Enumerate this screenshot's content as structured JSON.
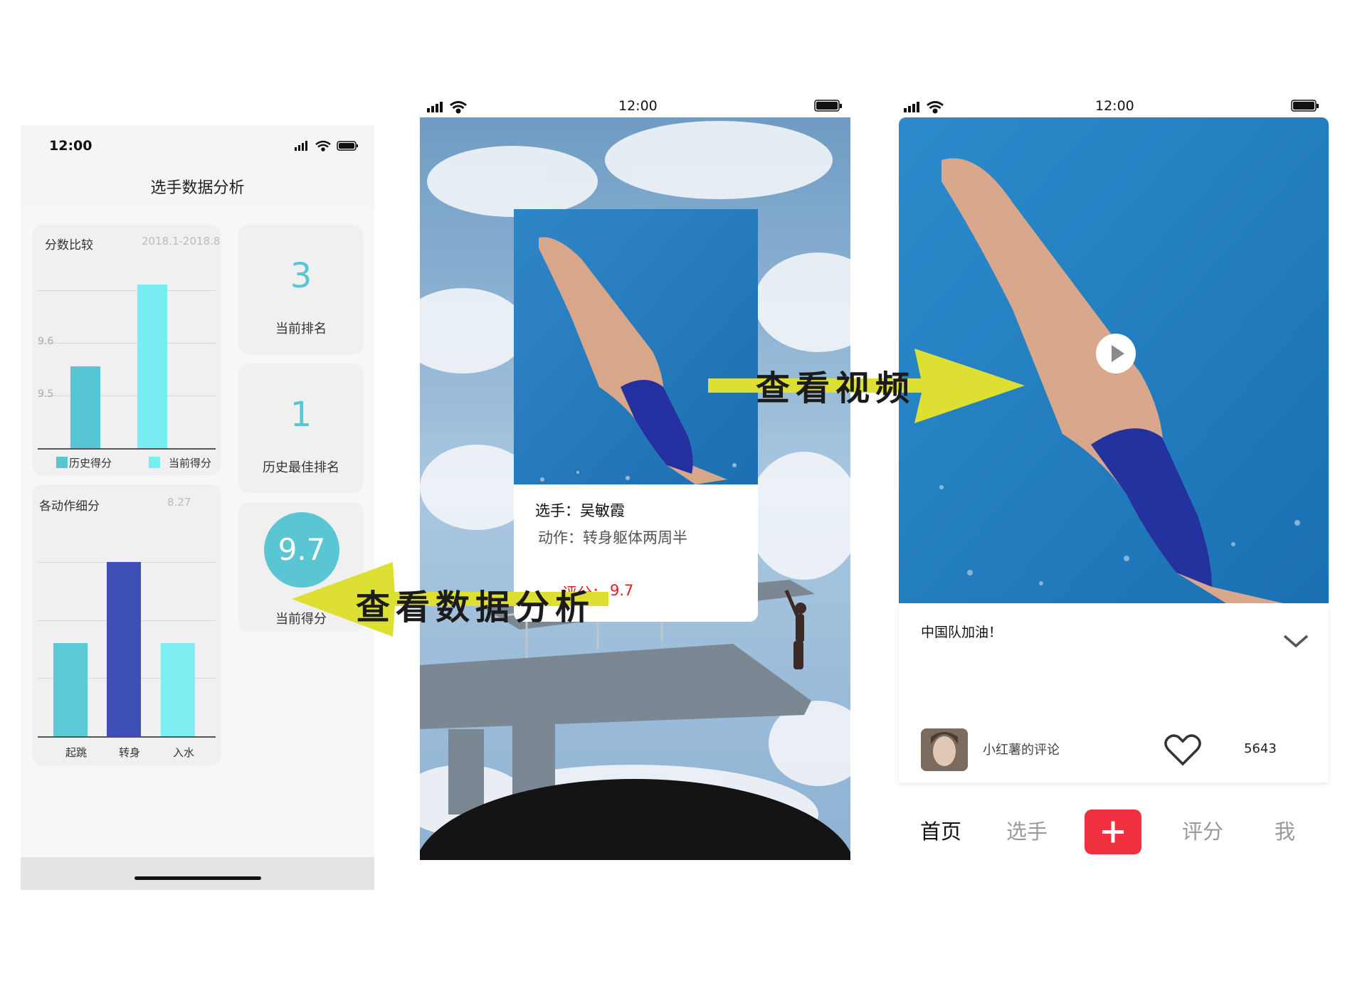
{
  "screen1": {
    "time": "12:00",
    "title": "选手数据分析",
    "score_compare": {
      "title": "分数比较",
      "date": "2018.1-2018.8",
      "y_ticks": [
        "9.6",
        "9.5"
      ],
      "legend": [
        "历史得分",
        "当前得分"
      ]
    },
    "action_breakdown": {
      "title": "各动作细分",
      "date": "8.27",
      "x_labels": [
        "起跳",
        "转身",
        "入水"
      ]
    },
    "stats": [
      {
        "value": "3",
        "label": "当前排名"
      },
      {
        "value": "1",
        "label": "历史最佳排名"
      },
      {
        "value": "9.7",
        "label": "当前得分"
      }
    ]
  },
  "chart_data": [
    {
      "type": "bar",
      "title": "分数比较",
      "subtitle": "2018.1-2018.8",
      "categories": [
        "历史得分",
        "当前得分"
      ],
      "values": [
        9.55,
        9.7
      ],
      "colors": [
        "#56c5d4",
        "#79eef2"
      ],
      "ylim": [
        9.4,
        9.72
      ],
      "y_ticks": [
        9.5,
        9.6
      ],
      "grid": true,
      "legend": "bottom"
    },
    {
      "type": "bar",
      "title": "各动作细分",
      "subtitle": "8.27",
      "categories": [
        "起跳",
        "转身",
        "入水"
      ],
      "values": [
        1.6,
        3.0,
        1.6
      ],
      "colors": [
        "#5ccad6",
        "#3f4fb8",
        "#7eeef2"
      ],
      "ylim": [
        0,
        3.0
      ],
      "grid": true
    }
  ],
  "screen2": {
    "time": "12:00",
    "athlete": "选手：吴敏霞",
    "action": "动作：转身躯体两周半",
    "score_label": "评分：",
    "score_value": "9.7"
  },
  "screen3": {
    "time": "12:00",
    "caption": "中国队加油！",
    "commenter": "小红薯的评论",
    "likes": "5643",
    "tabs": [
      "首页",
      "选手",
      "评分",
      "我"
    ],
    "add_symbol": "+"
  },
  "annotations": {
    "view_video": "查看视频",
    "view_analysis": "查看数据分析"
  },
  "icons": [
    "signal-icon",
    "wifi-icon",
    "battery-icon",
    "play-icon",
    "heart-icon",
    "chevron-down-icon",
    "plus-icon"
  ],
  "colors": {
    "accent_teal": "#5bc6d3",
    "bar_light": "#79eef2",
    "bar_blue": "#3f4fb8",
    "add_button": "#f0303e",
    "score_red": "#e02020",
    "arrow_yellow": "#dde032"
  }
}
